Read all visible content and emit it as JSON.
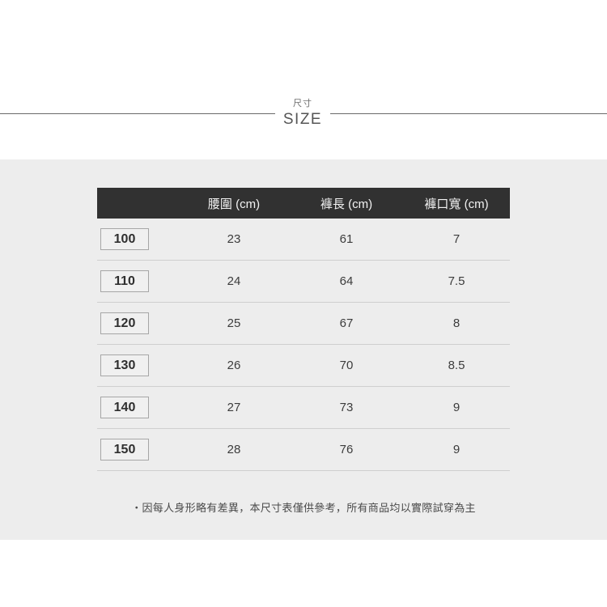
{
  "header": {
    "title_zh": "尺寸",
    "title_en": "SIZE"
  },
  "table": {
    "columns": [
      "",
      "腰圍 (cm)",
      "褲長 (cm)",
      "褲口寬 (cm)"
    ],
    "rows": [
      {
        "size": "100",
        "waist": "23",
        "length": "61",
        "hem": "7"
      },
      {
        "size": "110",
        "waist": "24",
        "length": "64",
        "hem": "7.5"
      },
      {
        "size": "120",
        "waist": "25",
        "length": "67",
        "hem": "8"
      },
      {
        "size": "130",
        "waist": "26",
        "length": "70",
        "hem": "8.5"
      },
      {
        "size": "140",
        "waist": "27",
        "length": "73",
        "hem": "9"
      },
      {
        "size": "150",
        "waist": "28",
        "length": "76",
        "hem": "9"
      }
    ]
  },
  "footnote": "・因每人身形略有差異，本尺寸表僅供參考，所有商品均以實際試穿為主",
  "colors": {
    "page_background": "#ffffff",
    "band_background": "#ededed",
    "header_bar": "#313131",
    "header_text": "#f2f2f2",
    "body_text": "#3c3c3c",
    "rule": "#6a6a6a",
    "row_divider": "#cfcfcf",
    "badge_border": "#a6a6a6",
    "badge_fill": "#f0f0f0"
  }
}
